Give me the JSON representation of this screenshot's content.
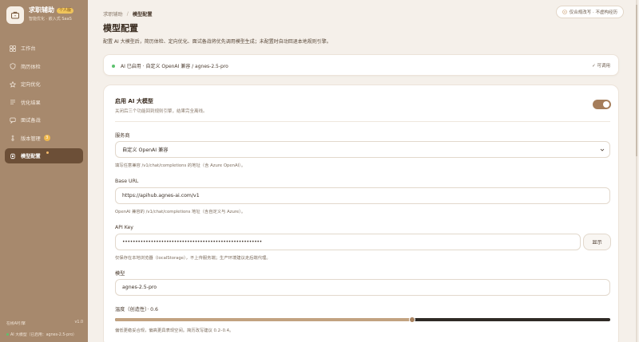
{
  "brand": {
    "title": "求职辅助",
    "badge": "个人版",
    "subtitle": "智能优化 · 嵌入式 SaaS"
  },
  "nav": {
    "items": [
      {
        "label": "工作台",
        "icon": "grid-icon"
      },
      {
        "label": "简历体检",
        "icon": "shield-icon"
      },
      {
        "label": "定向优化",
        "icon": "star-icon"
      },
      {
        "label": "优化结果",
        "icon": "list-icon"
      },
      {
        "label": "面试备战",
        "icon": "chat-icon"
      },
      {
        "label": "版本管理",
        "icon": "version-icon",
        "count": "3"
      },
      {
        "label": "模型配置",
        "icon": "cpu-icon",
        "active": true
      }
    ]
  },
  "side_footer": {
    "left": "在线AI引擎",
    "right": "v1.0",
    "status": "AI 大模型（已启用：agnes-2.5-pro）"
  },
  "topbar": {
    "breadcrumb_root": "求职辅助",
    "breadcrumb_sep": "/",
    "breadcrumb_current": "模型配置",
    "privacy_button": "仅合规改写 · 不虚构经历"
  },
  "page": {
    "title": "模型配置",
    "description": "配置 AI 大模型后，简历体检、定向优化、面试备战将优先调用模型生成；未配置时自动回退本地规则引擎。"
  },
  "status_card": {
    "text": "AI 已启用 · 自定义 OpenAI 兼容 / agnes-2.5-pro",
    "right": "✓ 可调用"
  },
  "config": {
    "enable_title": "启用 AI 大模型",
    "enable_desc": "关闭后三个功能回到规则引擎，结果完全离线。",
    "enabled": true,
    "provider_label": "服务商",
    "provider_value": "自定义 OpenAI 兼容",
    "provider_hint": "填写任意兼容 /v1/chat/completions 的地址（含 Azure OpenAI）。",
    "base_url_label": "Base URL",
    "base_url_value": "https://apihub.agnes-ai.com/v1",
    "base_url_hint": "OpenAI 兼容的 /v1/chat/completions 地址（含自定义与 Azure）。",
    "api_key_label": "API Key",
    "api_key_value": "••••••••••••••••••••••••••••••••••••••••••••••••••••••",
    "show_button": "显示",
    "api_key_hint": "仅保存在本地浏览器（localStorage），不上传服务端；生产环境建议走后端代理。",
    "model_label": "模型",
    "model_value": "agnes-2.5-pro",
    "temperature_label": "温度（创造性）· 0.6",
    "temperature": 0.6,
    "temperature_max": 1.0,
    "temperature_hint": "偏低更稳妥合规，偏高更具表现空间。简历改写建议 0.2–0.4。"
  },
  "colors": {
    "sidebar": "#a7896d",
    "active_nav": "#6c4f37",
    "accent": "#a57d5b",
    "background": "#f5f0ea",
    "success": "#5bc26d"
  }
}
